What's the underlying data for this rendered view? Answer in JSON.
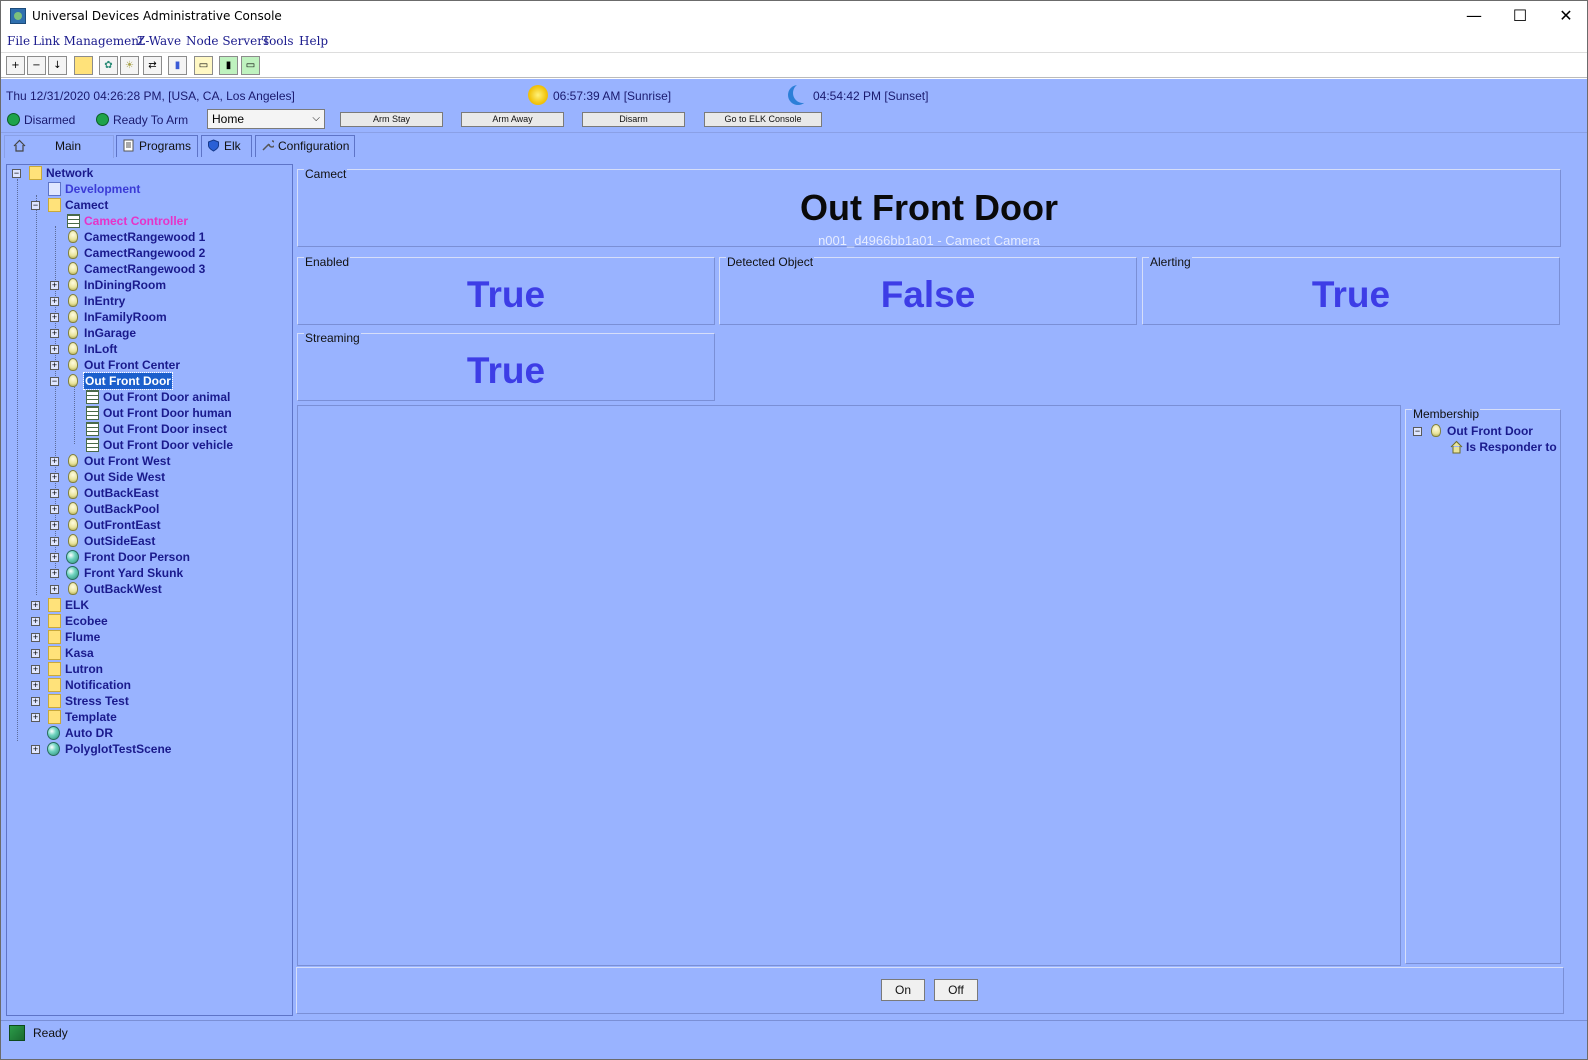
{
  "window": {
    "title": "Universal Devices Administrative Console",
    "min_glyph": "—",
    "max_glyph": "☐",
    "close_glyph": "✕"
  },
  "menu": [
    "File",
    "Link Management",
    "Z-Wave",
    "Node Servers",
    "Tools",
    "Help"
  ],
  "toolbar": {
    "icons": [
      "expand-all-icon",
      "collapse-all-icon",
      "sort-az-icon",
      "new-folder-icon",
      "new-scene-icon",
      "new-device-icon",
      "link-icon",
      "chart-icon",
      "panel-icon",
      "io-icon",
      "battery-icon"
    ],
    "glyphs": [
      "+",
      "−",
      "↓",
      "",
      "✿",
      "☀",
      "⇄",
      "▮",
      "▭",
      "▮",
      "▭"
    ]
  },
  "info": {
    "datetime": "Thu 12/31/2020 04:26:28 PM,  [USA, CA, Los Angeles]",
    "sunrise": "06:57:39 AM [Sunrise]",
    "sunset": "04:54:42 PM [Sunset]"
  },
  "security": {
    "disarmed": "Disarmed",
    "ready": "Ready To Arm",
    "mode": "Home",
    "buttons": {
      "arm_stay": "Arm Stay",
      "arm_away": "Arm Away",
      "disarm": "Disarm",
      "elk_console": "Go to ELK Console"
    }
  },
  "tabs": {
    "main": "Main",
    "programs": "Programs",
    "elk": "Elk",
    "configuration": "Configuration"
  },
  "tree": {
    "network": "Network",
    "development": "Development",
    "camect": "Camect",
    "camect_controller": "Camect Controller",
    "items": [
      "CamectRangewood 1",
      "CamectRangewood 2",
      "CamectRangewood 3",
      "InDiningRoom",
      "InEntry",
      "InFamilyRoom",
      "InGarage",
      "InLoft",
      "Out Front Center",
      "Out Front Door"
    ],
    "children": [
      "Out Front Door animal",
      "Out Front Door human",
      "Out Front Door insect",
      "Out Front Door vehicle"
    ],
    "items2": [
      "Out Front West",
      "Out Side West",
      "OutBackEast",
      "OutBackPool",
      "OutFrontEast",
      "OutSideEast"
    ],
    "scenes": [
      "Front Door Person",
      "Front Yard Skunk"
    ],
    "last": "OutBackWest",
    "folders": [
      "ELK",
      "Ecobee",
      "Flume",
      "Kasa",
      "Lutron",
      "Notification",
      "Stress Test",
      "Template"
    ],
    "auto_dr": "Auto DR",
    "polyglot": "PolyglotTestScene"
  },
  "detail": {
    "group_title": "Camect",
    "name": "Out Front Door",
    "address": "n001_d4966bb1a01 - Camect Camera",
    "props": [
      {
        "label": "Enabled",
        "value": "True"
      },
      {
        "label": "Detected Object",
        "value": "False"
      },
      {
        "label": "Alerting",
        "value": "True"
      },
      {
        "label": "Streaming",
        "value": "True"
      }
    ]
  },
  "membership": {
    "title": "Membership",
    "node": "Out Front Door",
    "child": "Is Responder to"
  },
  "commands": {
    "on": "On",
    "off": "Off"
  },
  "status": "Ready",
  "colors": {
    "background": "#99b3ff",
    "value_text": "#3d3de6",
    "tree_text": "#1a1a8c",
    "selection": "#1b5fcc"
  }
}
